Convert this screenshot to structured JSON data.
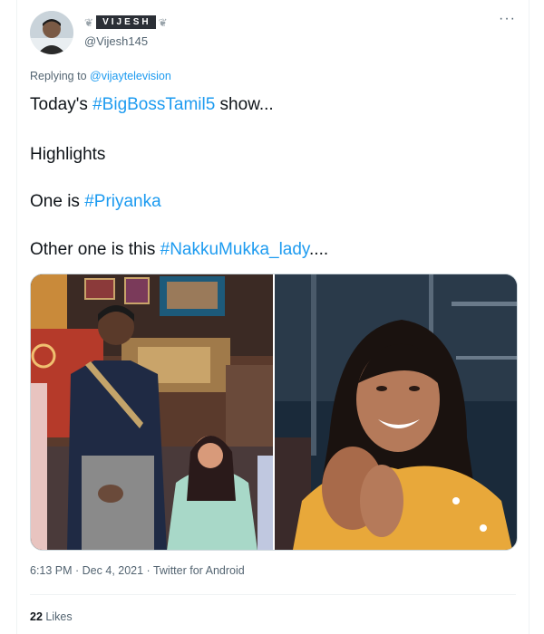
{
  "author": {
    "display_name": "VIJESH",
    "leaf_left": "❦",
    "leaf_right": "❦",
    "handle": "@Vijesh145"
  },
  "tweet": {
    "more_icon": "more-horizontal-icon",
    "more_label": "···",
    "replying_prefix": "Replying to",
    "replying_to": "@vijaytelevision",
    "line1_text": "Today's ",
    "line1_hashtag": "#BigBossTamil5",
    "line1_suffix": " show...",
    "line2_text": "Highlights",
    "line3_text": "One is ",
    "line3_hashtag": "#Priyanka",
    "line4_text": "Other one is this ",
    "line4_hashtag": "#NakkuMukka_lady",
    "line4_suffix": "....",
    "timestamp": "6:13 PM · Dec 4, 2021 · Twitter for Android",
    "likes_count": "22",
    "likes_label": "Likes"
  },
  "colors": {
    "hashtag": "#1d9bf0",
    "secondary_text": "#536471",
    "primary_text": "#0f1419",
    "border": "#cfd9de"
  }
}
